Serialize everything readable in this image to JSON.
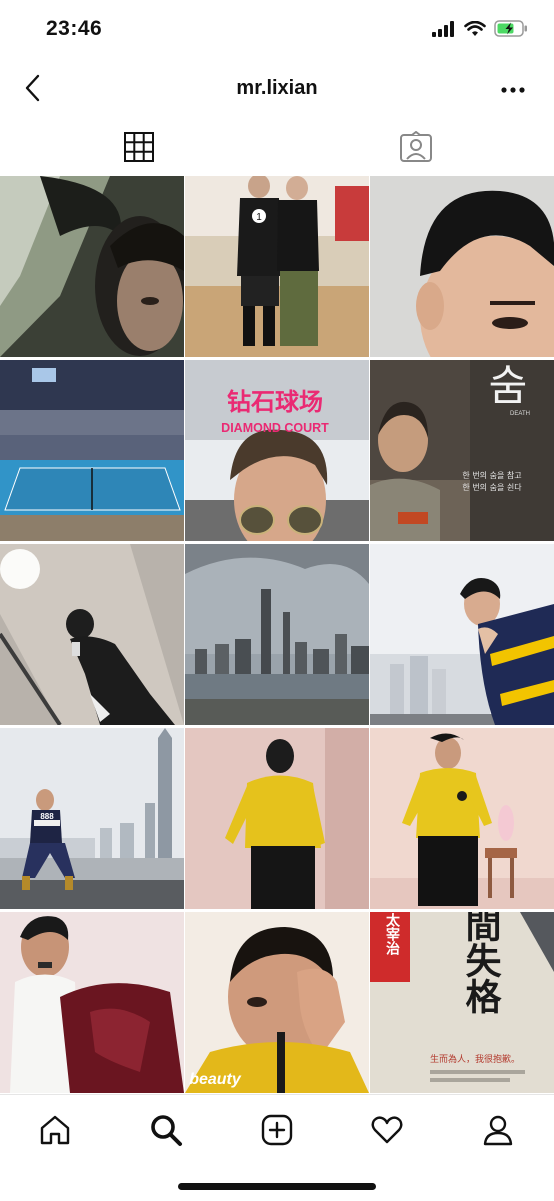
{
  "status": {
    "time": "23:46"
  },
  "header": {
    "title": "mr.lixian"
  },
  "tabs": [
    {
      "name": "posts-grid"
    },
    {
      "name": "tagged"
    }
  ],
  "posts": {
    "diamond_court_cn": "钻石球场",
    "diamond_court_en": "DIAMOND COURT",
    "jersey_no": "1",
    "movie_title": "숨",
    "movie_sub": "DEATH",
    "movie_caption_1": "한 번의 숨을 참고",
    "movie_caption_2": "한 번의 숨을 쉰다",
    "jacket_no": "888",
    "magazine": "beauty",
    "book_title": "人間失格",
    "book_author": "太宰治",
    "book_blurb": "生而為人，我很抱歉。"
  },
  "bottom_nav": [
    {
      "name": "home"
    },
    {
      "name": "search",
      "active": true
    },
    {
      "name": "new-post"
    },
    {
      "name": "activity"
    },
    {
      "name": "profile"
    }
  ]
}
